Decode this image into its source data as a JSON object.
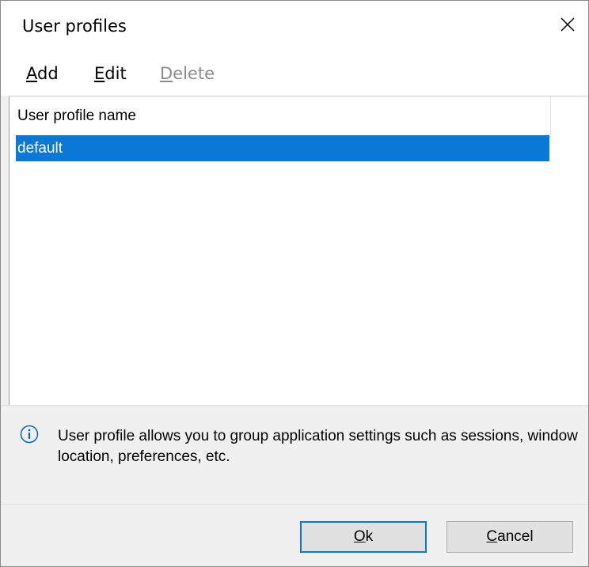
{
  "window": {
    "title": "User profiles",
    "close_icon": "close-icon"
  },
  "menu": {
    "items": [
      {
        "accel": "A",
        "rest": "dd",
        "label": "Add",
        "enabled": true
      },
      {
        "accel": "E",
        "rest": "dit",
        "label": "Edit",
        "enabled": true
      },
      {
        "accel": "D",
        "rest": "elete",
        "label": "Delete",
        "enabled": false
      }
    ]
  },
  "list": {
    "column_header": "User profile name",
    "rows": [
      {
        "name": "default",
        "selected": true
      }
    ],
    "selection_color": "#0a78d7"
  },
  "info": {
    "icon": "info-icon",
    "text": "User profile allows you to group application settings such as sessions, window location, preferences, etc."
  },
  "buttons": {
    "ok": {
      "accel": "O",
      "rest": "k",
      "label": "Ok",
      "default": true
    },
    "cancel": {
      "accel": "C",
      "rest": "ancel",
      "label": "Cancel"
    }
  },
  "colors": {
    "accent": "#0078d7",
    "dialog_bg": "#f0f0f0"
  }
}
